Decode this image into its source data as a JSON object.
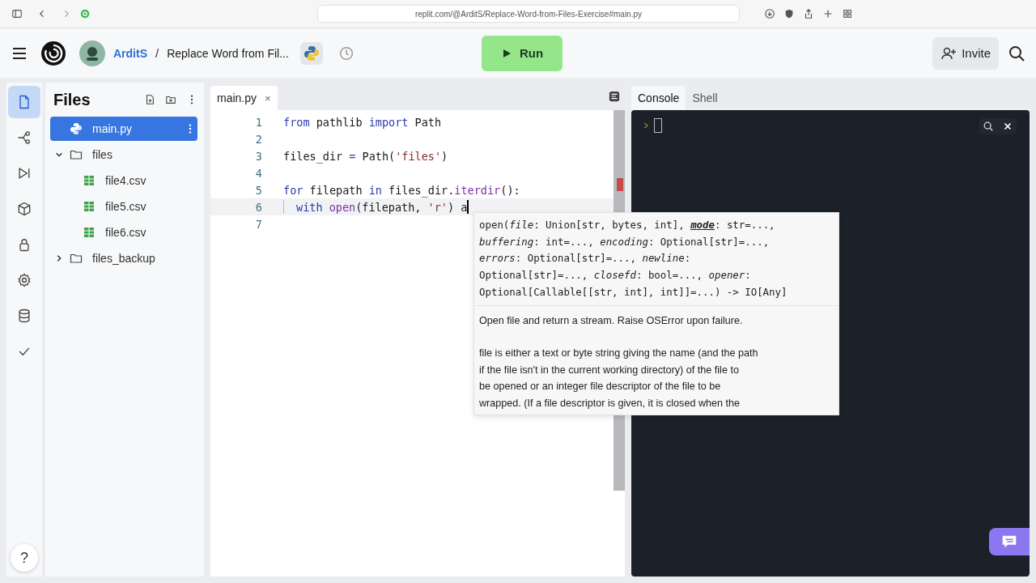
{
  "browser": {
    "url": "replit.com/@ArditS/Replace-Word-from-Files-Exercise#main.py"
  },
  "header": {
    "user": "ArditS",
    "separator": "/",
    "repl_title": "Replace Word from Fil...",
    "run_label": "Run",
    "invite_label": "Invite"
  },
  "rail": [
    {
      "kind": "files",
      "selected": true
    },
    {
      "kind": "git",
      "selected": false
    },
    {
      "kind": "debugger",
      "selected": false
    },
    {
      "kind": "packages",
      "selected": false
    },
    {
      "kind": "secrets",
      "selected": false
    },
    {
      "kind": "settings",
      "selected": false
    },
    {
      "kind": "database",
      "selected": false
    },
    {
      "kind": "tests",
      "selected": false
    }
  ],
  "help_label": "?",
  "files": {
    "title": "Files",
    "tree": [
      {
        "name": "main.py",
        "kind": "python",
        "selected": true
      },
      {
        "name": "files",
        "kind": "folder",
        "expanded": true,
        "selected": false,
        "children": [
          {
            "name": "file4.csv",
            "kind": "csv",
            "selected": false
          },
          {
            "name": "file5.csv",
            "kind": "csv",
            "selected": false
          },
          {
            "name": "file6.csv",
            "kind": "csv",
            "selected": false
          }
        ]
      },
      {
        "name": "files_backup",
        "kind": "folder",
        "expanded": false,
        "selected": false
      }
    ]
  },
  "editor": {
    "tab": "main.py",
    "close": "×",
    "lines": [
      {
        "number": "1",
        "active": false,
        "tokens": [
          {
            "text": "from",
            "kind": "kw"
          },
          {
            "text": " pathlib ",
            "kind": "plain"
          },
          {
            "text": "import",
            "kind": "kw"
          },
          {
            "text": " Path",
            "kind": "plain"
          }
        ]
      },
      {
        "number": "2",
        "active": false
      },
      {
        "number": "3",
        "active": false,
        "tokens": [
          {
            "text": "files_dir ",
            "kind": "plain"
          },
          {
            "text": "=",
            "kind": "kw"
          },
          {
            "text": " Path(",
            "kind": "plain"
          },
          {
            "text": "'files'",
            "kind": "str"
          },
          {
            "text": ")",
            "kind": "plain"
          }
        ]
      },
      {
        "number": "4",
        "active": false
      },
      {
        "number": "5",
        "active": false,
        "tokens": [
          {
            "text": "for",
            "kind": "kw"
          },
          {
            "text": " filepath ",
            "kind": "plain"
          },
          {
            "text": "in",
            "kind": "kw"
          },
          {
            "text": " files_dir.",
            "kind": "plain"
          },
          {
            "text": "iterdir",
            "kind": "fn"
          },
          {
            "text": "():",
            "kind": "plain"
          }
        ]
      },
      {
        "number": "6",
        "active": true,
        "tokens": [
          {
            "text": "with ",
            "kind": "kw"
          },
          {
            "text": "open",
            "kind": "fn"
          },
          {
            "text": "(filepath, ",
            "kind": "plain"
          },
          {
            "text": "'r'",
            "kind": "str"
          },
          {
            "text": ") a",
            "kind": "plain"
          }
        ]
      },
      {
        "number": "7",
        "active": false
      }
    ],
    "tooltip": {
      "signature": [
        [
          {
            "text": "open(",
            "kind": "plain"
          },
          {
            "text": "file",
            "kind": "param"
          },
          {
            "text": ": Union[str, bytes, int], ",
            "kind": "plain"
          },
          {
            "text": "mode",
            "kind": "active"
          },
          {
            "text": ": str=...,",
            "kind": "plain"
          }
        ],
        [
          {
            "text": "buffering",
            "kind": "param"
          },
          {
            "text": ": int=..., ",
            "kind": "plain"
          },
          {
            "text": "encoding",
            "kind": "param"
          },
          {
            "text": ": Optional[str]=...,",
            "kind": "plain"
          }
        ],
        [
          {
            "text": "errors",
            "kind": "param"
          },
          {
            "text": ": Optional[str]=..., ",
            "kind": "plain"
          },
          {
            "text": "newline",
            "kind": "param"
          },
          {
            "text": ":",
            "kind": "plain"
          }
        ],
        [
          {
            "text": "Optional[str]=..., ",
            "kind": "plain"
          },
          {
            "text": "closefd",
            "kind": "param"
          },
          {
            "text": ": bool=..., ",
            "kind": "plain"
          },
          {
            "text": "opener",
            "kind": "param"
          },
          {
            "text": ":",
            "kind": "plain"
          }
        ],
        [
          {
            "text": "Optional[Callable[[str, int], int]]=...) -> IO[Any]",
            "kind": "plain"
          }
        ]
      ],
      "summary": "Open file and return a stream.  Raise OSError upon failure.",
      "detail": [
        "file is either a text or byte string giving the name (and the path",
        "if the file isn't in the current working directory) of the file to",
        "be opened or an integer file descriptor of the file to be",
        "wrapped. (If a file descriptor is given, it is closed when the"
      ]
    }
  },
  "console": {
    "tabs": [
      {
        "label": "Console",
        "selected": true
      },
      {
        "label": "Shell",
        "selected": false
      }
    ]
  }
}
